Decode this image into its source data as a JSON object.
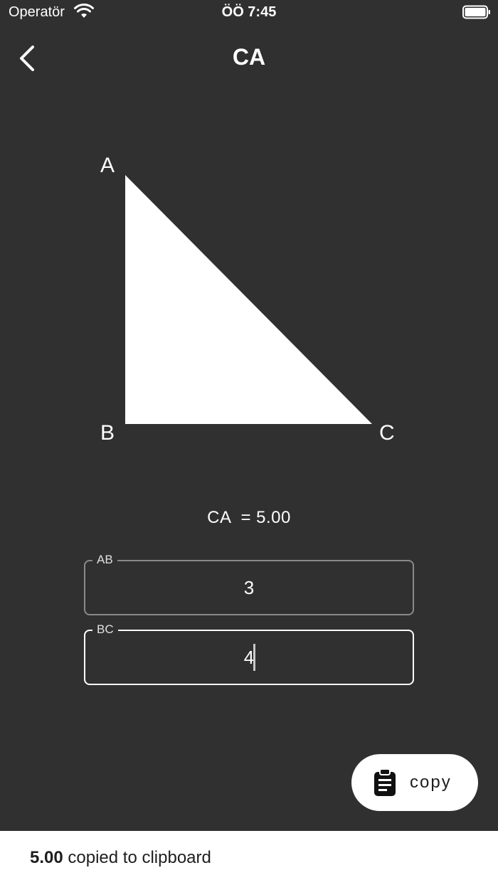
{
  "status_bar": {
    "carrier": "Operatör",
    "time": "ÖÖ 7:45"
  },
  "nav": {
    "title": "CA"
  },
  "diagram": {
    "vertices": [
      "A",
      "B",
      "C"
    ],
    "fill_color": "#ffffff"
  },
  "result": {
    "text": "CA  = 5.00"
  },
  "fields": {
    "ab": {
      "label": "AB",
      "value": "3"
    },
    "bc": {
      "label": "BC",
      "value": "4"
    }
  },
  "copy_button": {
    "label": "copy"
  },
  "snackbar": {
    "value": "5.00",
    "message": " copied to clipboard"
  },
  "colors": {
    "background": "#303030",
    "surface": "#ffffff",
    "field_border": "#8a8a8a"
  }
}
